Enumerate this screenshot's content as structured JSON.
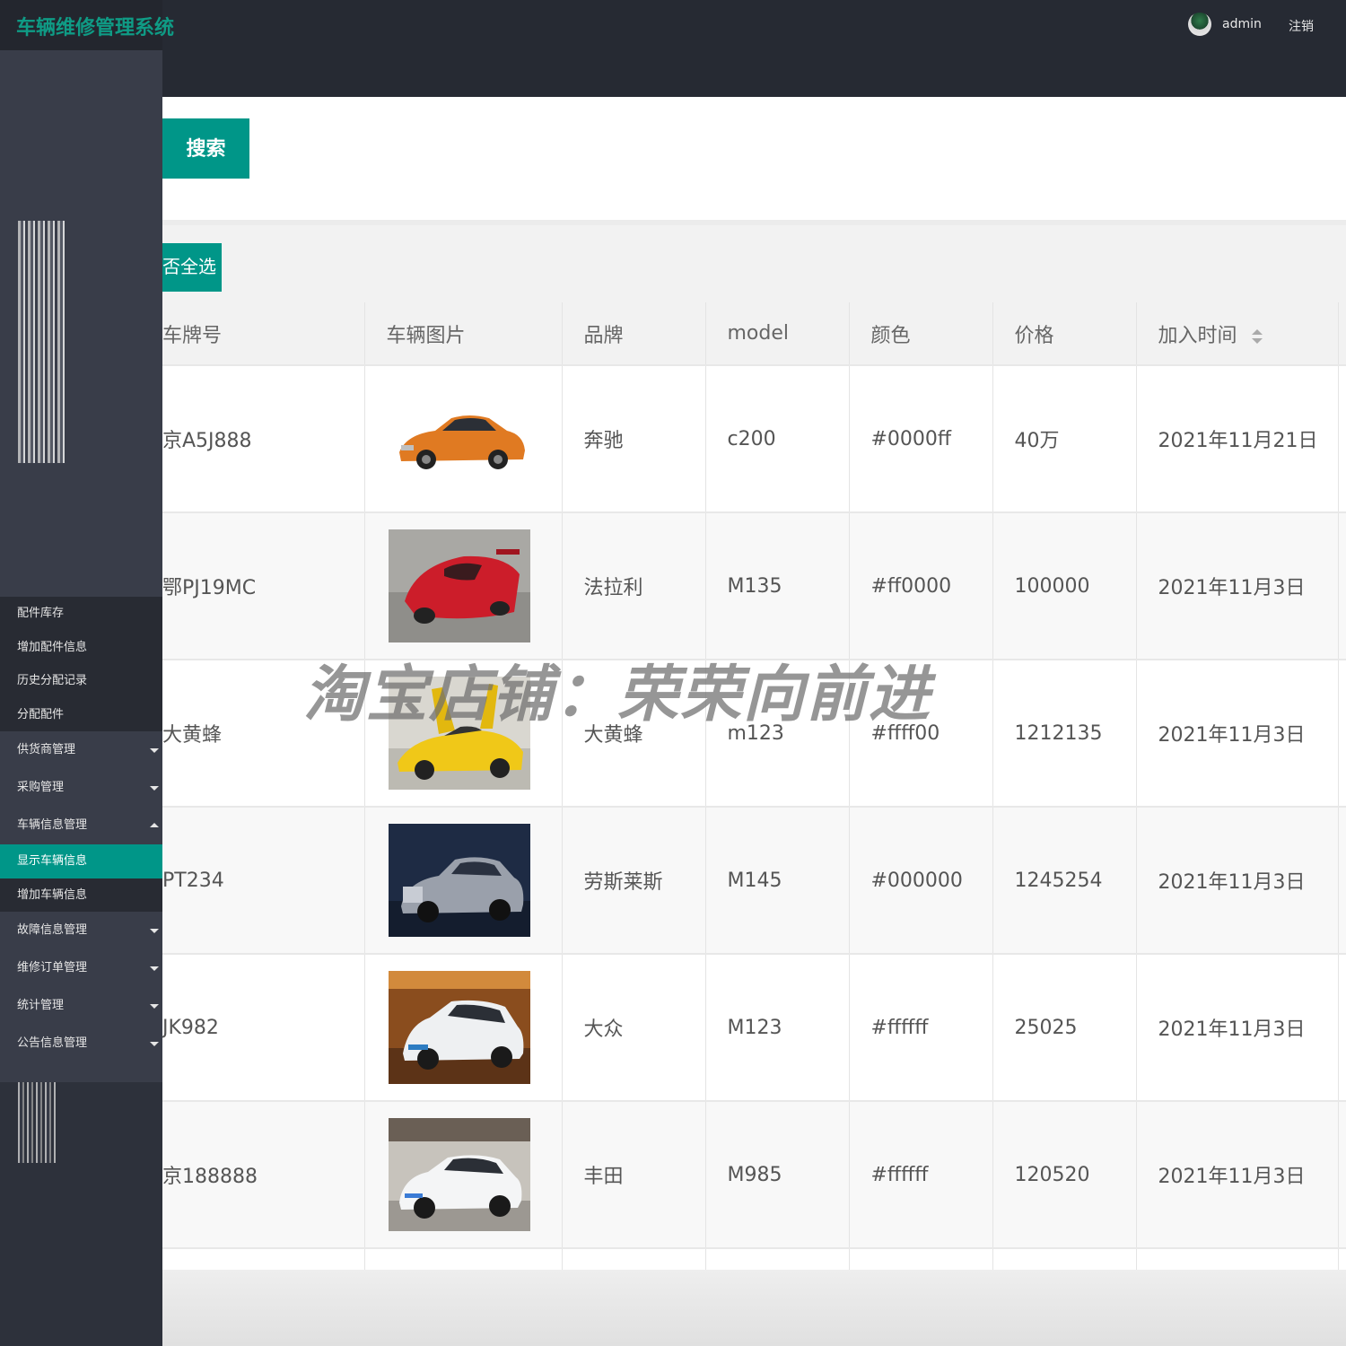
{
  "header": {
    "title": "车辆维修管理系统",
    "user": "admin",
    "logout_label": "注销"
  },
  "sidebar": {
    "items": [
      {
        "label": "配件库存",
        "type": "child"
      },
      {
        "label": "增加配件信息",
        "type": "child"
      },
      {
        "label": "历史分配记录",
        "type": "child"
      },
      {
        "label": "分配配件",
        "type": "child"
      },
      {
        "label": "供货商管理",
        "type": "parent",
        "caret": "down"
      },
      {
        "label": "采购管理",
        "type": "parent",
        "caret": "down"
      },
      {
        "label": "车辆信息管理",
        "type": "parent",
        "caret": "up"
      },
      {
        "label": "显示车辆信息",
        "type": "child",
        "active": true
      },
      {
        "label": "增加车辆信息",
        "type": "child"
      },
      {
        "label": "故障信息管理",
        "type": "parent",
        "caret": "down"
      },
      {
        "label": "维修订单管理",
        "type": "parent",
        "caret": "down"
      },
      {
        "label": "统计管理",
        "type": "parent",
        "caret": "down"
      },
      {
        "label": "公告信息管理",
        "type": "parent",
        "caret": "down"
      }
    ]
  },
  "search": {
    "button_label": "搜索"
  },
  "toolbar": {
    "select_all_label": "否全选"
  },
  "table": {
    "columns": [
      "车牌号",
      "车辆图片",
      "品牌",
      "model",
      "颜色",
      "价格",
      "加入时间"
    ],
    "rows": [
      {
        "plate": "京A5J888",
        "brand": "奔驰",
        "model": "c200",
        "color": "#0000ff",
        "price": "40万",
        "date": "2021年11月21日",
        "img": "orange-sedan"
      },
      {
        "plate": "鄂PJ19MC",
        "brand": "法拉利",
        "model": "M135",
        "color": "#ff0000",
        "price": "100000",
        "date": "2021年11月3日",
        "img": "red-sports-car"
      },
      {
        "plate": "大黄蜂",
        "brand": "大黄蜂",
        "model": "m123",
        "color": "#ffff00",
        "price": "1212135",
        "date": "2021年11月3日",
        "img": "yellow-supercar"
      },
      {
        "plate": "PT234",
        "brand": "劳斯莱斯",
        "model": "M145",
        "color": "#000000",
        "price": "1245254",
        "date": "2021年11月3日",
        "img": "silver-luxury-car"
      },
      {
        "plate": "JK982",
        "brand": "大众",
        "model": "M123",
        "color": "#ffffff",
        "price": "25025",
        "date": "2021年11月3日",
        "img": "white-suv"
      },
      {
        "plate": "京188888",
        "brand": "丰田",
        "model": "M985",
        "color": "#ffffff",
        "price": "120520",
        "date": "2021年11月3日",
        "img": "white-hatchback"
      }
    ]
  },
  "watermark": "淘宝店铺：荣荣向前进",
  "theme": {
    "accent": "#009688",
    "header_bg": "#262a33",
    "sidebar_bg": "#393d49"
  }
}
